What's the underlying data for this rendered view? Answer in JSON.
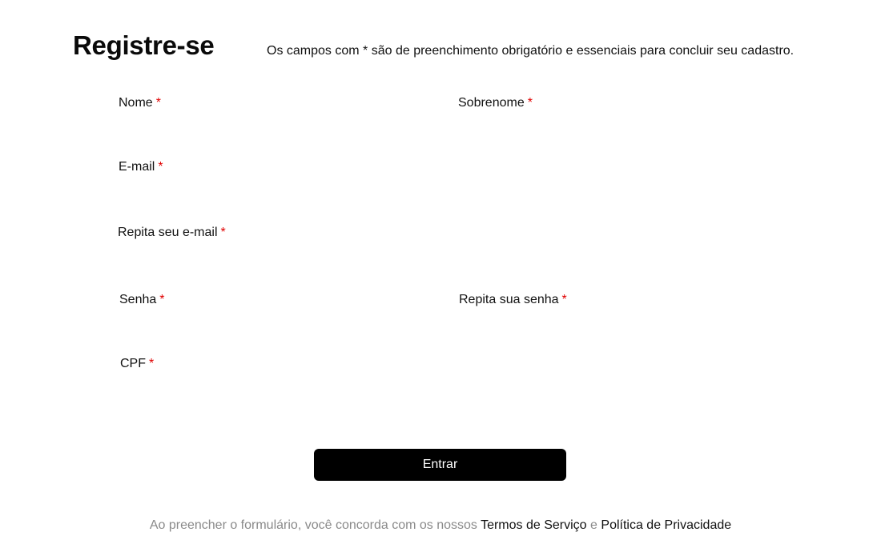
{
  "header": {
    "title": "Registre-se",
    "notice": "Os campos com * são de preenchimento obrigatório e essenciais para concluir seu cadastro."
  },
  "form": {
    "required_mark": "*",
    "fields": {
      "nome": {
        "label": "Nome",
        "value": ""
      },
      "sobrenome": {
        "label": "Sobrenome",
        "value": ""
      },
      "email": {
        "label": "E-mail",
        "value": ""
      },
      "email_confirm": {
        "label": "Repita seu e-mail",
        "value": ""
      },
      "senha": {
        "label": "Senha",
        "value": ""
      },
      "senha_confirm": {
        "label": "Repita sua senha",
        "value": ""
      },
      "cpf": {
        "label": "CPF",
        "value": ""
      }
    },
    "submit_label": "Entrar"
  },
  "footer": {
    "text_before": "Ao preencher o formulário, você concorda com os nossos",
    "terms_link": "Termos de Serviço",
    "conjunction": "e",
    "privacy_link": "Política de Privacidade"
  },
  "colors": {
    "required": "#e00000",
    "button_bg": "#000000",
    "button_text": "#ffffff",
    "muted_text": "#8a8a8a"
  }
}
